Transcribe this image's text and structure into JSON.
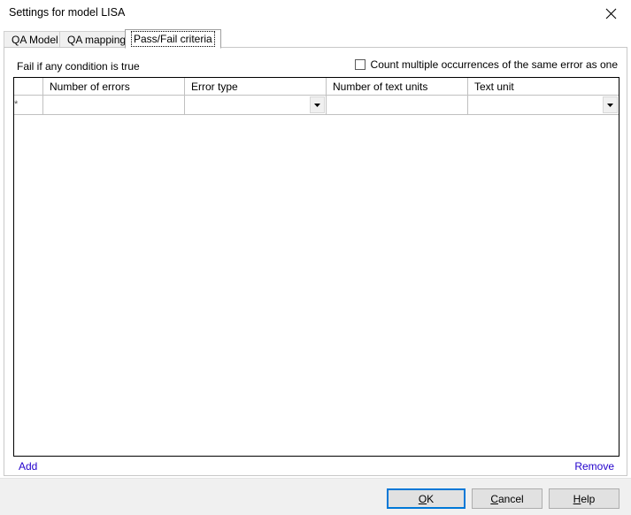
{
  "window": {
    "title": "Settings for model LISA",
    "close_icon": "close-icon"
  },
  "tabs": [
    {
      "label": "QA Model",
      "active": false
    },
    {
      "label": "QA mappings",
      "active": false
    },
    {
      "label": "Pass/Fail criteria",
      "active": true
    }
  ],
  "panel": {
    "fail_label": "Fail if any condition is true",
    "count_multiple": {
      "label": "Count multiple occurrences of the same error as one",
      "checked": false
    }
  },
  "grid": {
    "columns": [
      {
        "key": "marker",
        "header": ""
      },
      {
        "key": "number_of_errors",
        "header": "Number of errors"
      },
      {
        "key": "error_type",
        "header": "Error type"
      },
      {
        "key": "number_of_text_units",
        "header": "Number of text units"
      },
      {
        "key": "text_unit",
        "header": "Text unit"
      }
    ],
    "rows": [
      {
        "marker": "*",
        "number_of_errors": "",
        "error_type": "",
        "number_of_text_units": "",
        "text_unit": ""
      }
    ],
    "dropdown_icon": "chevron-down-icon"
  },
  "links": {
    "add": "Add",
    "remove": "Remove"
  },
  "footer": {
    "ok": {
      "accel": "O",
      "rest": "K"
    },
    "cancel": {
      "accel": "C",
      "rest": "ancel"
    },
    "help": {
      "accel": "H",
      "rest": "elp"
    }
  },
  "colors": {
    "link": "#2200CC",
    "default_button_border": "#0078D7",
    "footer_background": "#F0F0F0",
    "grid_border": "#000000"
  }
}
